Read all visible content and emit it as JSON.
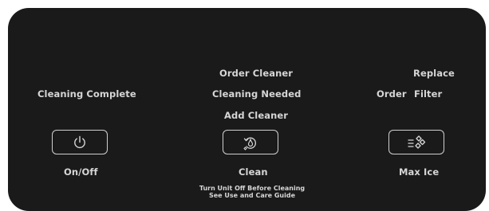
{
  "panel": {
    "left": {
      "indicator": "Cleaning Complete",
      "button_label": "On/Off",
      "button_icon": "power-icon"
    },
    "center": {
      "indicator_top": "Order Cleaner",
      "indicator_mid": "Cleaning Needed",
      "indicator_bottom": "Add Cleaner",
      "button_label": "Clean",
      "button_icon": "clean-cycle-icon",
      "note_line1": "Turn Unit Off Before Cleaning",
      "note_line2": "See Use and Care Guide"
    },
    "right": {
      "indicator_replace": "Replace",
      "indicator_order": "Order",
      "indicator_filter": "Filter",
      "button_label": "Max Ice",
      "button_icon": "max-ice-icon"
    }
  },
  "colors": {
    "panel_bg": "#1a1a1a",
    "text": "#d6d6d6",
    "button_border": "#cfcfcf"
  }
}
